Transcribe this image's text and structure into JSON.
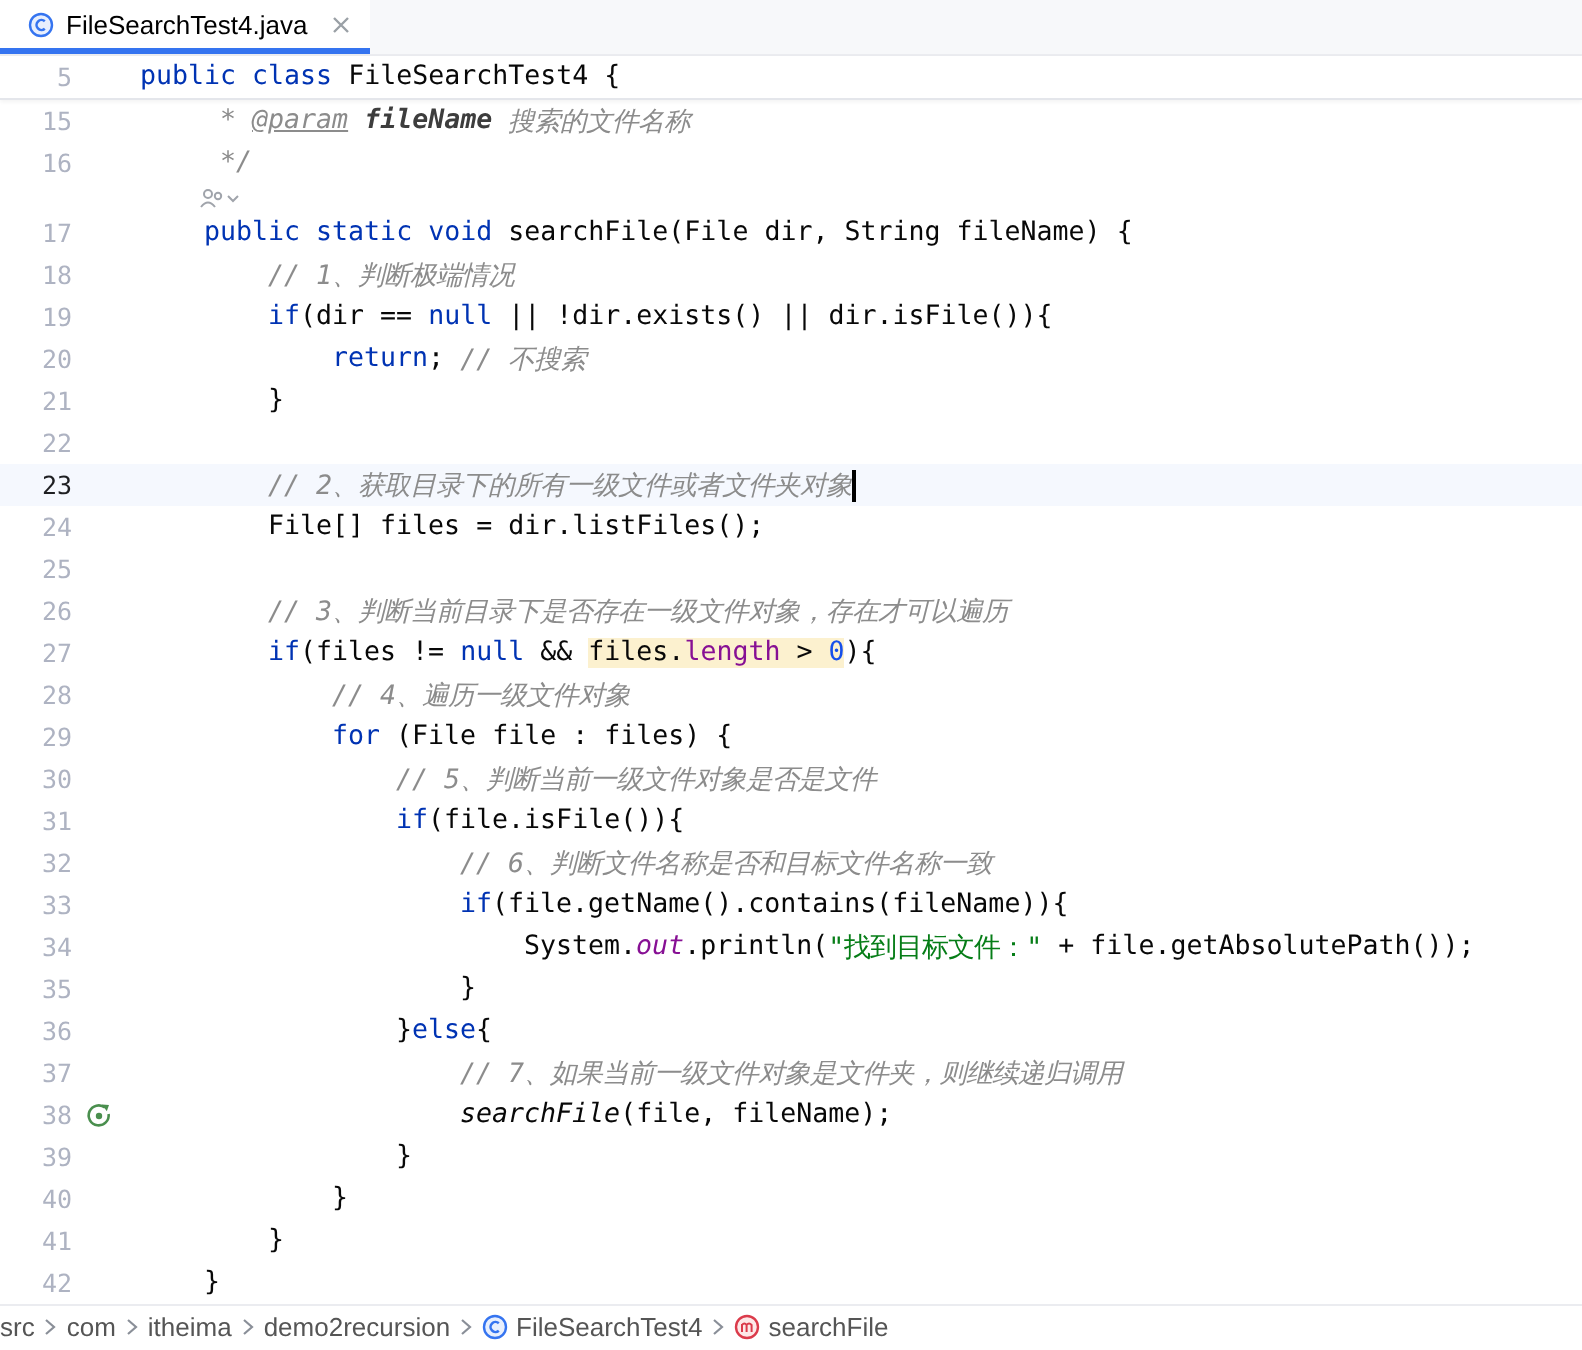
{
  "tabs": [
    {
      "label": "FileSearchTest4.java",
      "selected": true
    }
  ],
  "sticky_line": {
    "number": "5",
    "tokens": [
      {
        "kind": "kw",
        "text": "public class"
      },
      {
        "kind": "plain",
        "text": " FileSearchTest4 {"
      }
    ]
  },
  "lines": [
    {
      "number": "15",
      "current": false,
      "tokens": [
        {
          "kind": "comment",
          "text": "     * "
        },
        {
          "kind": "doc-tag",
          "text": "@param"
        },
        {
          "kind": "doc-param",
          "text": " fileName"
        },
        {
          "kind": "comment",
          "text": " 搜索的文件名称"
        }
      ]
    },
    {
      "number": "16",
      "current": false,
      "tokens": [
        {
          "kind": "comment",
          "text": "     */"
        }
      ]
    },
    {
      "number": "17",
      "current": false,
      "usages_hint": true,
      "tokens": [
        {
          "kind": "kw",
          "text": "    public static void"
        },
        {
          "kind": "plain",
          "text": " searchFile(File dir, String fileName) {"
        }
      ]
    },
    {
      "number": "18",
      "current": false,
      "tokens": [
        {
          "kind": "comment",
          "text": "        // 1、判断极端情况"
        }
      ]
    },
    {
      "number": "19",
      "current": false,
      "tokens": [
        {
          "kind": "kw",
          "text": "        if"
        },
        {
          "kind": "plain",
          "text": "(dir == "
        },
        {
          "kind": "kw",
          "text": "null"
        },
        {
          "kind": "plain",
          "text": " || !dir.exists() || dir.isFile()){"
        }
      ]
    },
    {
      "number": "20",
      "current": false,
      "tokens": [
        {
          "kind": "kw",
          "text": "            return"
        },
        {
          "kind": "plain",
          "text": ";"
        },
        {
          "kind": "comment",
          "text": " // 不搜索"
        }
      ]
    },
    {
      "number": "21",
      "current": false,
      "tokens": [
        {
          "kind": "plain",
          "text": "        }"
        }
      ]
    },
    {
      "number": "22",
      "current": false
    },
    {
      "number": "23",
      "current": true,
      "tokens": [
        {
          "kind": "comment",
          "text": "        // 2、获取目录下的所有一级文件或者文件夹对象"
        }
      ]
    },
    {
      "number": "24",
      "current": false,
      "tokens": [
        {
          "kind": "plain",
          "text": "        File[] files = dir.listFiles();"
        }
      ]
    },
    {
      "number": "25",
      "current": false
    },
    {
      "number": "26",
      "current": false,
      "tokens": [
        {
          "kind": "comment",
          "text": "        // 3、判断当前目录下是否存在一级文件对象，存在才可以遍历"
        }
      ]
    },
    {
      "number": "27",
      "current": false,
      "tokens": [
        {
          "kind": "kw",
          "text": "        if"
        },
        {
          "kind": "plain",
          "text": "(files != "
        },
        {
          "kind": "kw",
          "text": "null"
        },
        {
          "kind": "plain",
          "text": " && "
        },
        {
          "kind": "usage-highlight",
          "tokens": [
            {
              "kind": "plain",
              "text": "files."
            },
            {
              "kind": "field",
              "text": "length"
            },
            {
              "kind": "plain",
              "text": " > "
            },
            {
              "kind": "num",
              "text": "0"
            }
          ]
        },
        {
          "kind": "plain",
          "text": "){"
        }
      ]
    },
    {
      "number": "28",
      "current": false,
      "tokens": [
        {
          "kind": "comment",
          "text": "            // 4、遍历一级文件对象"
        }
      ]
    },
    {
      "number": "29",
      "current": false,
      "tokens": [
        {
          "kind": "kw",
          "text": "            for"
        },
        {
          "kind": "plain",
          "text": " (File file : files) {"
        }
      ]
    },
    {
      "number": "30",
      "current": false,
      "tokens": [
        {
          "kind": "comment",
          "text": "                // 5、判断当前一级文件对象是否是文件"
        }
      ]
    },
    {
      "number": "31",
      "current": false,
      "tokens": [
        {
          "kind": "kw",
          "text": "                if"
        },
        {
          "kind": "plain",
          "text": "(file.isFile()){"
        }
      ]
    },
    {
      "number": "32",
      "current": false,
      "tokens": [
        {
          "kind": "comment",
          "text": "                    // 6、判断文件名称是否和目标文件名称一致"
        }
      ]
    },
    {
      "number": "33",
      "current": false,
      "tokens": [
        {
          "kind": "kw",
          "text": "                    if"
        },
        {
          "kind": "plain",
          "text": "(file.getName().contains(fileName)){"
        }
      ]
    },
    {
      "number": "34",
      "current": false,
      "tokens": [
        {
          "kind": "plain",
          "text": "                        System."
        },
        {
          "kind": "static-field",
          "text": "out"
        },
        {
          "kind": "plain",
          "text": ".println("
        },
        {
          "kind": "str",
          "text": "\"找到目标文件：\""
        },
        {
          "kind": "plain",
          "text": " + file.getAbsolutePath());"
        }
      ]
    },
    {
      "number": "35",
      "current": false,
      "tokens": [
        {
          "kind": "plain",
          "text": "                    }"
        }
      ]
    },
    {
      "number": "36",
      "current": false,
      "tokens": [
        {
          "kind": "plain",
          "text": "                }"
        },
        {
          "kind": "kw",
          "text": "else"
        },
        {
          "kind": "plain",
          "text": "{"
        }
      ]
    },
    {
      "number": "37",
      "current": false,
      "tokens": [
        {
          "kind": "comment",
          "text": "                    // 7、如果当前一级文件对象是文件夹，则继续递归调用"
        }
      ]
    },
    {
      "number": "38",
      "current": false,
      "recursive_call": true,
      "tokens": [
        {
          "kind": "static-call",
          "text": "                    searchFile"
        },
        {
          "kind": "plain",
          "text": "(file, fileName);"
        }
      ]
    },
    {
      "number": "39",
      "current": false,
      "tokens": [
        {
          "kind": "plain",
          "text": "                }"
        }
      ]
    },
    {
      "number": "40",
      "current": false,
      "tokens": [
        {
          "kind": "plain",
          "text": "            }"
        }
      ]
    },
    {
      "number": "41",
      "current": false,
      "tokens": [
        {
          "kind": "plain",
          "text": "        }"
        }
      ]
    },
    {
      "number": "42",
      "current": false,
      "tokens": [
        {
          "kind": "plain",
          "text": "    }"
        }
      ]
    }
  ],
  "breadcrumb": [
    {
      "kind": "folder",
      "label": "src"
    },
    {
      "kind": "folder",
      "label": "com"
    },
    {
      "kind": "folder",
      "label": "itheima"
    },
    {
      "kind": "folder",
      "label": "demo2recursion"
    },
    {
      "kind": "class",
      "label": "FileSearchTest4"
    },
    {
      "kind": "method",
      "label": "searchFile"
    }
  ]
}
